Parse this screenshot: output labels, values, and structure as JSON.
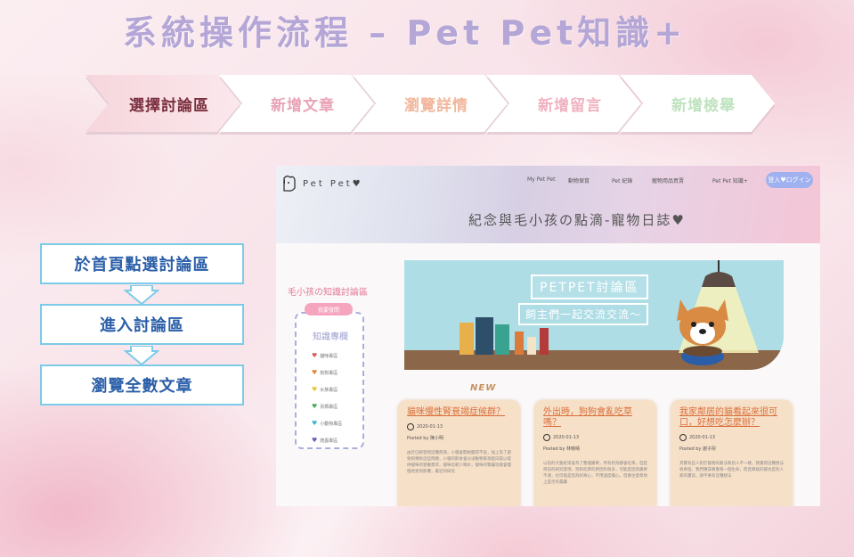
{
  "slide": {
    "title": "系統操作流程 – Pet Pet知識+"
  },
  "steps": [
    {
      "label": "選擇討論區",
      "color": "#7a2f3e",
      "active": true
    },
    {
      "label": "新增文章",
      "color": "#e9a4b6",
      "active": false
    },
    {
      "label": "瀏覽詳情",
      "color": "#f2b79c",
      "active": false
    },
    {
      "label": "新增留言",
      "color": "#f0b1c0",
      "active": false
    },
    {
      "label": "新增檢舉",
      "color": "#bfe3bf",
      "active": false
    }
  ],
  "flow": [
    {
      "label": "於首頁點選討論區"
    },
    {
      "label": "進入討論區"
    },
    {
      "label": "瀏覽全數文章"
    }
  ],
  "site": {
    "logo": "Pet Pet♥",
    "nav": [
      "My Pet Pet",
      "動物保育",
      "Pet 紀錄",
      "寵物用品買賣",
      "Pet Pet 知識+"
    ],
    "login": "登入♥ログイン",
    "hero": "紀念與毛小孩の點滴-寵物日誌♥",
    "sidebar": {
      "title": "毛小孩の知識討論區",
      "new_post": "我要發問",
      "box_title": "知識專欄",
      "items": [
        {
          "label": "貓咪專區",
          "heart": "#e05a5a"
        },
        {
          "label": "狗狗專區",
          "heart": "#e08a3a"
        },
        {
          "label": "水族專區",
          "heart": "#e6c832"
        },
        {
          "label": "鳥類專區",
          "heart": "#4cae5a"
        },
        {
          "label": "小動物專區",
          "heart": "#3ab7d8"
        },
        {
          "label": "爬蟲專區",
          "heart": "#6a5ab8"
        }
      ]
    },
    "banner": {
      "title": "PETPET討論區",
      "subtitle": "飼主們一起交流交流～"
    },
    "new_tag": "NEW",
    "cards": [
      {
        "title": "貓咪慢性腎衰竭症候群？",
        "date": "2020-01-13",
        "author": "Posted by 陳小明",
        "body": "由於已經發現這種疾病，小貓會開始變得不良，加上為了避免和預防這些問題，小貓的飲食會分泌動物來源蛋白質以提供貓咪的營養需求，貓咪比較少喝水，貓咪的腎臟功能會慢慢地受到影響，最近的研究"
      },
      {
        "title": "外出時，狗狗會亂吃草嗎？",
        "date": "2020-01-13",
        "author": "Posted by 林曉晴",
        "body": "以前的犬隻經常會為了整理腸胃，所有狗狗都會吃草，但是目前的研究發現，狗狗吃草的原因有很多，可能是因為腸胃不適，也可能是因為好奇心，不用過度擔心，但要注意草地上是否有農藥"
      },
      {
        "title": "我家鄰居的貓看起來很可口，好想吃怎麼辦？",
        "date": "2020-01-13",
        "author": "Posted by 謝子彤",
        "body": "其實有些人對於寵物的看法和別人不一樣，我覺得這種想法很奇怪，我們應該尊重每一個生命，而且鄰居的貓也是別人家的寶貝，請不要有這種想法"
      }
    ]
  }
}
